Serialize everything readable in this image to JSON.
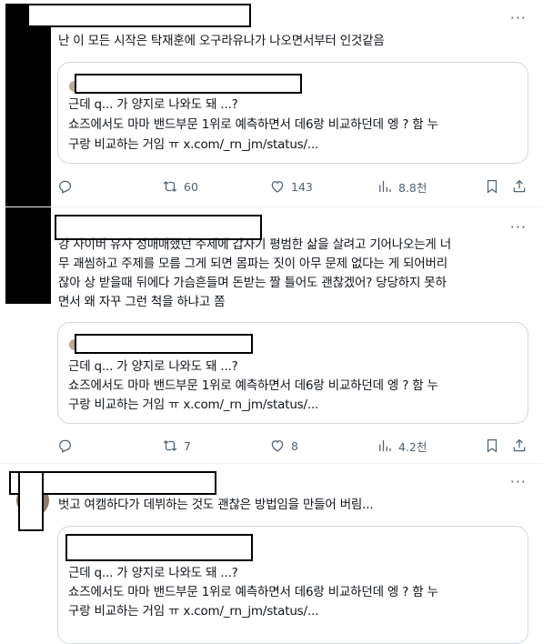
{
  "posts": [
    {
      "text": "난 이 모든 시작은 탁재훈에 오구라유나가 나오면서부터 인것같음",
      "more": "···",
      "quote": {
        "line1": "근데 q... 가 양지로 나와도 돼 ...?",
        "line2": "쇼즈에서도 마마 밴드부문 1위로 예측하면서 데6랑 비교하던데 엥 ? 함 누",
        "line3": "구랑 비교하는 거임 ㅠ x.com/_rn_jm/status/..."
      },
      "actions": {
        "reply": "",
        "repost": "60",
        "like": "143",
        "views": "8.8천"
      }
    },
    {
      "text": "강 사이버 유사 성매매했던 주제에 갑자기 평범한 삶을 살려고 기어나오는게 너\n무 괘씸하고 주제를 모름 그게 되면 몸파는 짓이 아무 문제 없다는 게 되어버리\n잖아 상 받을때 뒤에다 가슴흔들며 돈받는 짤 틀어도 괜찮겠어? 당당하지 못하\n면서 왜 자꾸 그런 척을 하냐고 쫌",
      "more": "···",
      "quote": {
        "line1": "근데 q... 가 양지로 나와도 돼 ...?",
        "line2": "쇼즈에서도 마마 밴드부문 1위로 예측하면서 데6랑 비교하던데 엥 ? 함 누",
        "line3": "구랑 비교하는 거임 ㅠ x.com/_rn_jm/status/..."
      },
      "actions": {
        "reply": "",
        "repost": "7",
        "like": "8",
        "views": "4.2천"
      }
    },
    {
      "text": "벗고 여캠하다가 데뷔하는 것도 괜찮은 방법임을 만들어 버림...",
      "more": "···",
      "quote": {
        "line1": "근데 q... 가 양지로 나와도 돼 ...?",
        "line2": "쇼즈에서도 마마 밴드부문 1위로 예측하면서 데6랑 비교하던데 엥 ? 함 누",
        "line3": "구랑 비교하는 거임 ㅠ x.com/_rn_jm/status/..."
      }
    }
  ],
  "icons": {
    "reply": "reply-icon",
    "repost": "repost-icon",
    "like": "heart-icon",
    "views": "views-icon",
    "bookmark": "bookmark-icon",
    "share": "share-icon",
    "more": "more-icon"
  },
  "colors": {
    "text": "#0f1419",
    "muted": "#536471",
    "border": "#cfd9de",
    "redaction": "#000000"
  }
}
